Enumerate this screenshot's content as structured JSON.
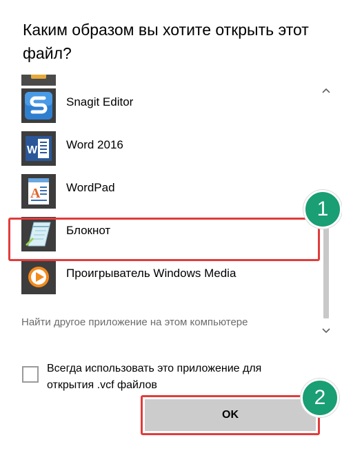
{
  "dialog": {
    "title": "Каким образом вы хотите открыть этот файл?",
    "apps": [
      {
        "label": "Snagit Editor",
        "icon": "snagit-editor-icon"
      },
      {
        "label": "Word 2016",
        "icon": "word-2016-icon"
      },
      {
        "label": "WordPad",
        "icon": "wordpad-icon"
      },
      {
        "label": "Блокнот",
        "icon": "notepad-icon"
      },
      {
        "label": "Проигрыватель Windows Media",
        "icon": "windows-media-player-icon"
      }
    ],
    "other_app_link": "Найти другое приложение на этом компьютере",
    "always_use_label": "Всегда использовать это приложение для открытия .vcf файлов",
    "always_use_checked": false,
    "ok_label": "OK"
  },
  "annotations": {
    "step1": "1",
    "step2": "2",
    "highlight_color": "#e23b3b",
    "badge_color": "#1a9e74"
  }
}
